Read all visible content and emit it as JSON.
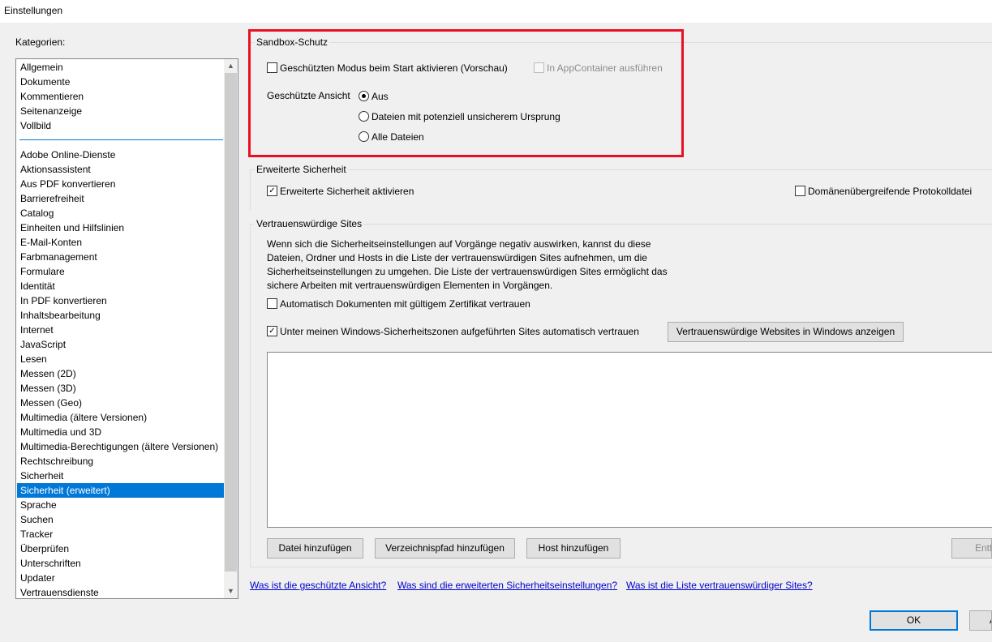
{
  "window": {
    "title": "Einstellungen"
  },
  "categories": {
    "label": "Kategorien:",
    "top_items": [
      "Allgemein",
      "Dokumente",
      "Kommentieren",
      "Seitenanzeige",
      "Vollbild"
    ],
    "items": [
      "Adobe Online-Dienste",
      "Aktionsassistent",
      "Aus PDF konvertieren",
      "Barrierefreiheit",
      "Catalog",
      "Einheiten und Hilfslinien",
      "E-Mail-Konten",
      "Farbmanagement",
      "Formulare",
      "Identität",
      "In PDF konvertieren",
      "Inhaltsbearbeitung",
      "Internet",
      "JavaScript",
      "Lesen",
      "Messen (2D)",
      "Messen (3D)",
      "Messen (Geo)",
      "Multimedia (ältere Versionen)",
      "Multimedia und 3D",
      "Multimedia-Berechtigungen (ältere Versionen)",
      "Rechtschreibung",
      "Sicherheit",
      "Sicherheit (erweitert)",
      "Sprache",
      "Suchen",
      "Tracker",
      "Überprüfen",
      "Unterschriften",
      "Updater",
      "Vertrauensdienste"
    ],
    "selected": "Sicherheit (erweitert)"
  },
  "sandbox": {
    "legend": "Sandbox-Schutz",
    "protected_mode": {
      "label": "Geschützten Modus beim Start aktivieren (Vorschau)",
      "checked": false
    },
    "appcontainer": {
      "label": "In AppContainer ausführen",
      "checked": false,
      "disabled": true
    },
    "protected_view_label": "Geschützte Ansicht",
    "radio_off": "Aus",
    "radio_unsafe": "Dateien mit potenziell unsicherem Ursprung",
    "radio_all": "Alle Dateien",
    "selected": "Aus"
  },
  "enhanced": {
    "legend": "Erweiterte Sicherheit",
    "enable": {
      "label": "Erweiterte Sicherheit aktivieren",
      "checked": true
    },
    "crossdomain": {
      "label": "Domänenübergreifende Protokolldatei",
      "checked": false
    }
  },
  "trusted": {
    "legend": "Vertrauenswürdige Sites",
    "description": "Wenn sich die Sicherheitseinstellungen auf Vorgänge negativ auswirken, kannst du diese Dateien, Ordner und Hosts in die Liste der vertrauenswürdigen Sites aufnehmen, um die Sicherheitseinstellungen zu umgehen. Die Liste der vertrauenswürdigen Sites ermöglicht das sichere Arbeiten mit vertrauenswürdigen Elementen in Vorgängen.",
    "cert": {
      "label": "Automatisch Dokumenten mit gültigem Zertifikat vertrauen",
      "checked": false
    },
    "zones": {
      "label": "Unter meinen Windows-Sicherheitszonen aufgeführten Sites automatisch vertrauen",
      "checked": true
    },
    "show_windows_sites": "Vertrauenswürdige Websites in Windows anzeigen",
    "add_file": "Datei hinzufügen",
    "add_folder": "Verzeichnispfad hinzufügen",
    "add_host": "Host hinzufügen",
    "remove": "Entf"
  },
  "links": {
    "protected_view": "Was ist die geschützte Ansicht?",
    "enhanced": "Was sind die erweiterten Sicherheitseinstellungen?",
    "trusted_list": "Was ist die Liste vertrauenswürdiger Sites?"
  },
  "footer": {
    "ok": "OK",
    "cancel": "A"
  },
  "colors": {
    "highlight": "#e81123",
    "selection": "#0078d7",
    "link": "#0000cc"
  }
}
